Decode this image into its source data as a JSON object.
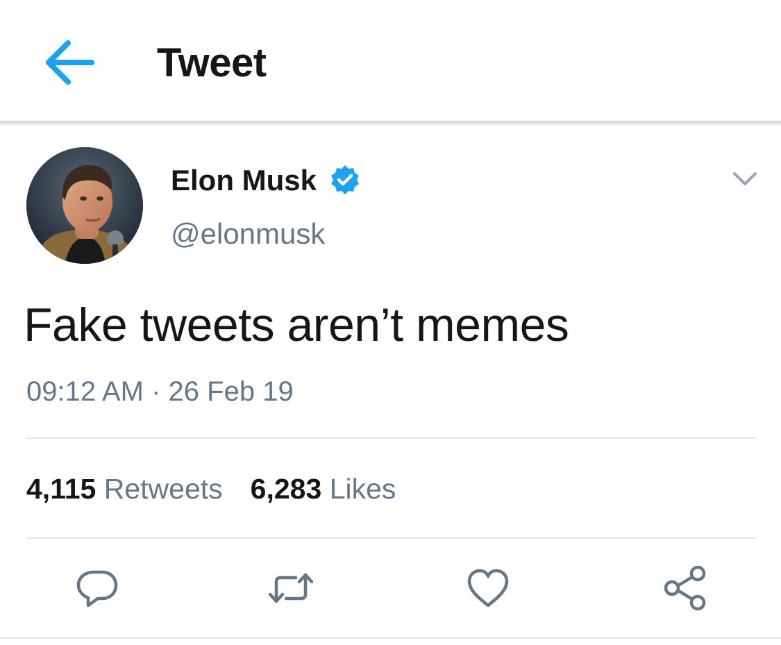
{
  "header": {
    "title": "Tweet",
    "back_icon": "arrow-left-icon"
  },
  "author": {
    "name": "Elon Musk",
    "handle": "@elonmusk",
    "verified": true,
    "avatar_icon": "profile-photo"
  },
  "tweet": {
    "text": "Fake tweets aren’t memes",
    "timestamp": "09:12 AM · 26 Feb 19"
  },
  "stats": {
    "retweets_count": "4,115",
    "retweets_label": "Retweets",
    "likes_count": "6,283",
    "likes_label": "Likes"
  },
  "actions": [
    {
      "icon": "reply-icon"
    },
    {
      "icon": "retweet-icon"
    },
    {
      "icon": "like-icon"
    },
    {
      "icon": "share-icon"
    }
  ],
  "colors": {
    "accent": "#1da1f2",
    "text_primary": "#14171a",
    "text_secondary": "#657786",
    "divider": "#e1e8ed"
  }
}
